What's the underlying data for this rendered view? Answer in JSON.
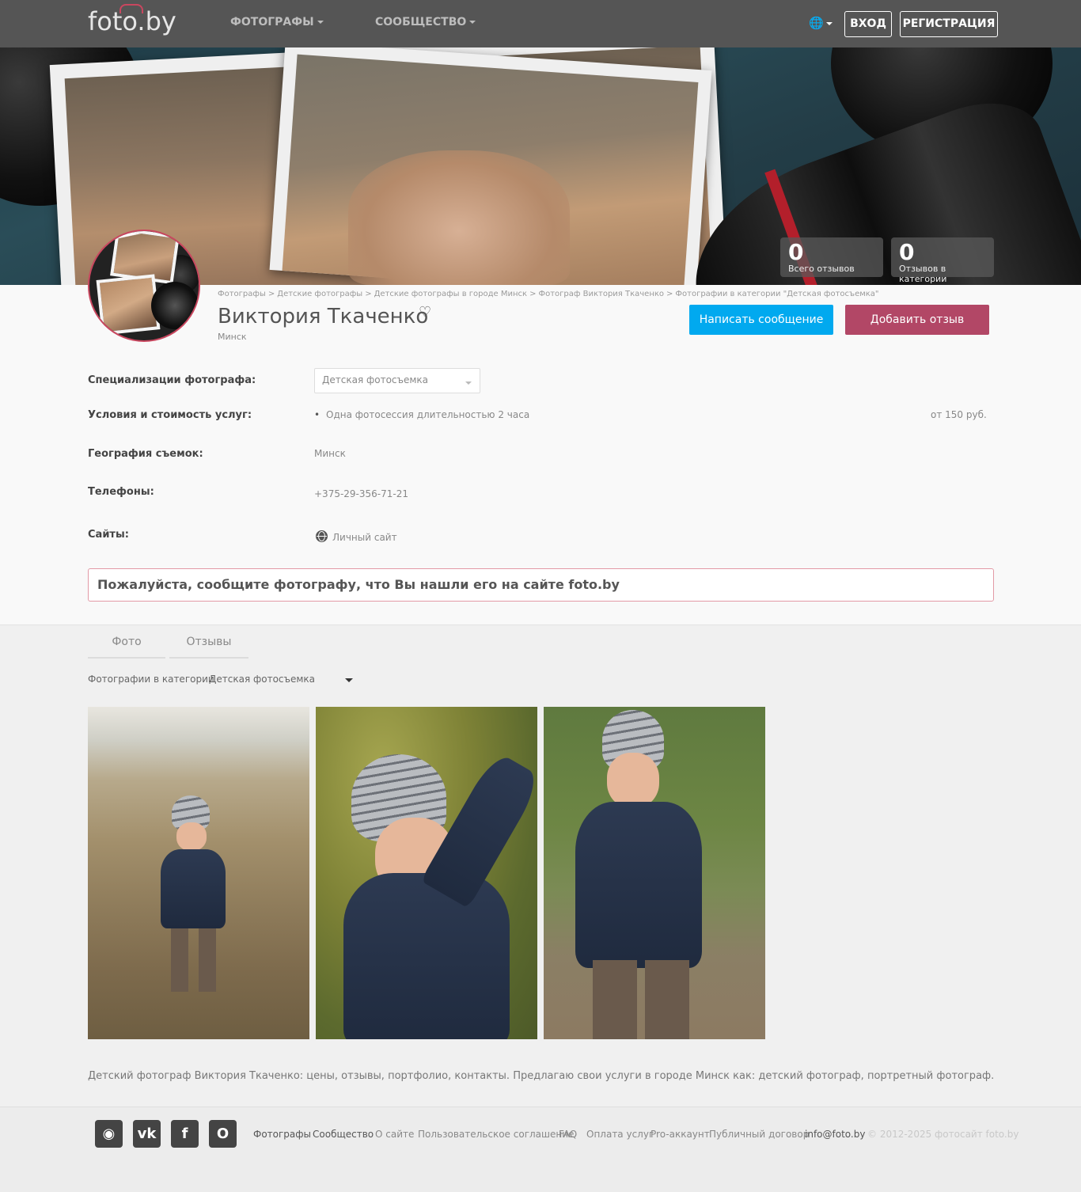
{
  "header": {
    "logo": "foto.by",
    "nav": [
      {
        "label": "ФОТОГРАФЫ"
      },
      {
        "label": "СООБЩЕСТВО"
      }
    ],
    "login": "ВХОД",
    "register": "РЕГИСТРАЦИЯ"
  },
  "stats": [
    {
      "value": "0",
      "label": "Всего отзывов"
    },
    {
      "value": "0",
      "label": "Отзывов в категории"
    }
  ],
  "breadcrumb": [
    "Фотографы",
    "Детские фотографы",
    "Детские фотографы в городе Минск",
    "Фотограф Виктория Ткаченко",
    "Фотографии в категории \"Детская фотосъемка\""
  ],
  "breadcrumb_sep": ">",
  "profile": {
    "name": "Виктория Ткаченко",
    "city": "Минск",
    "message_button": "Написать сообщение",
    "review_button": "Добавить отзыв"
  },
  "details": {
    "spec_label": "Специализации фотографа:",
    "spec_value": "Детская фотосъемка",
    "terms_label": "Условия и стоимость услуг:",
    "terms_item": "Одна фотосессия длительностью 2 часа",
    "terms_price": "от 150 руб.",
    "geo_label": "География съемок:",
    "geo_value": "Минск",
    "phones_label": "Телефоны:",
    "phones_value": "+375-29-356-71-21",
    "sites_label": "Сайты:",
    "sites_value": "Личный сайт"
  },
  "notice": "Пожалуйста, сообщите фотографу, что Вы нашли его на сайте foto.by",
  "tabs": [
    {
      "label": "Фото"
    },
    {
      "label": "Отзывы"
    }
  ],
  "category": {
    "label": "Фотографии в категории",
    "value": "Детская фотосъемка"
  },
  "seo_text": "Детский фотограф Виктория Ткаченко: цены, отзывы, портфолио, контакты. Предлагаю свои услуги в городе Минск как: детский фотограф, портретный фотограф.",
  "footer": {
    "social": [
      "instagram",
      "vk",
      "facebook",
      "odnoklassniki"
    ],
    "links": [
      "Фотографы",
      "Сообщество",
      "О сайте",
      "Пользовательское соглашение",
      "FAQ",
      "Оплата услуг",
      "Pro-аккаунт",
      "Публичный договор",
      "info@foto.by"
    ],
    "copyright": "© 2012-2025 фотосайт foto.by"
  }
}
